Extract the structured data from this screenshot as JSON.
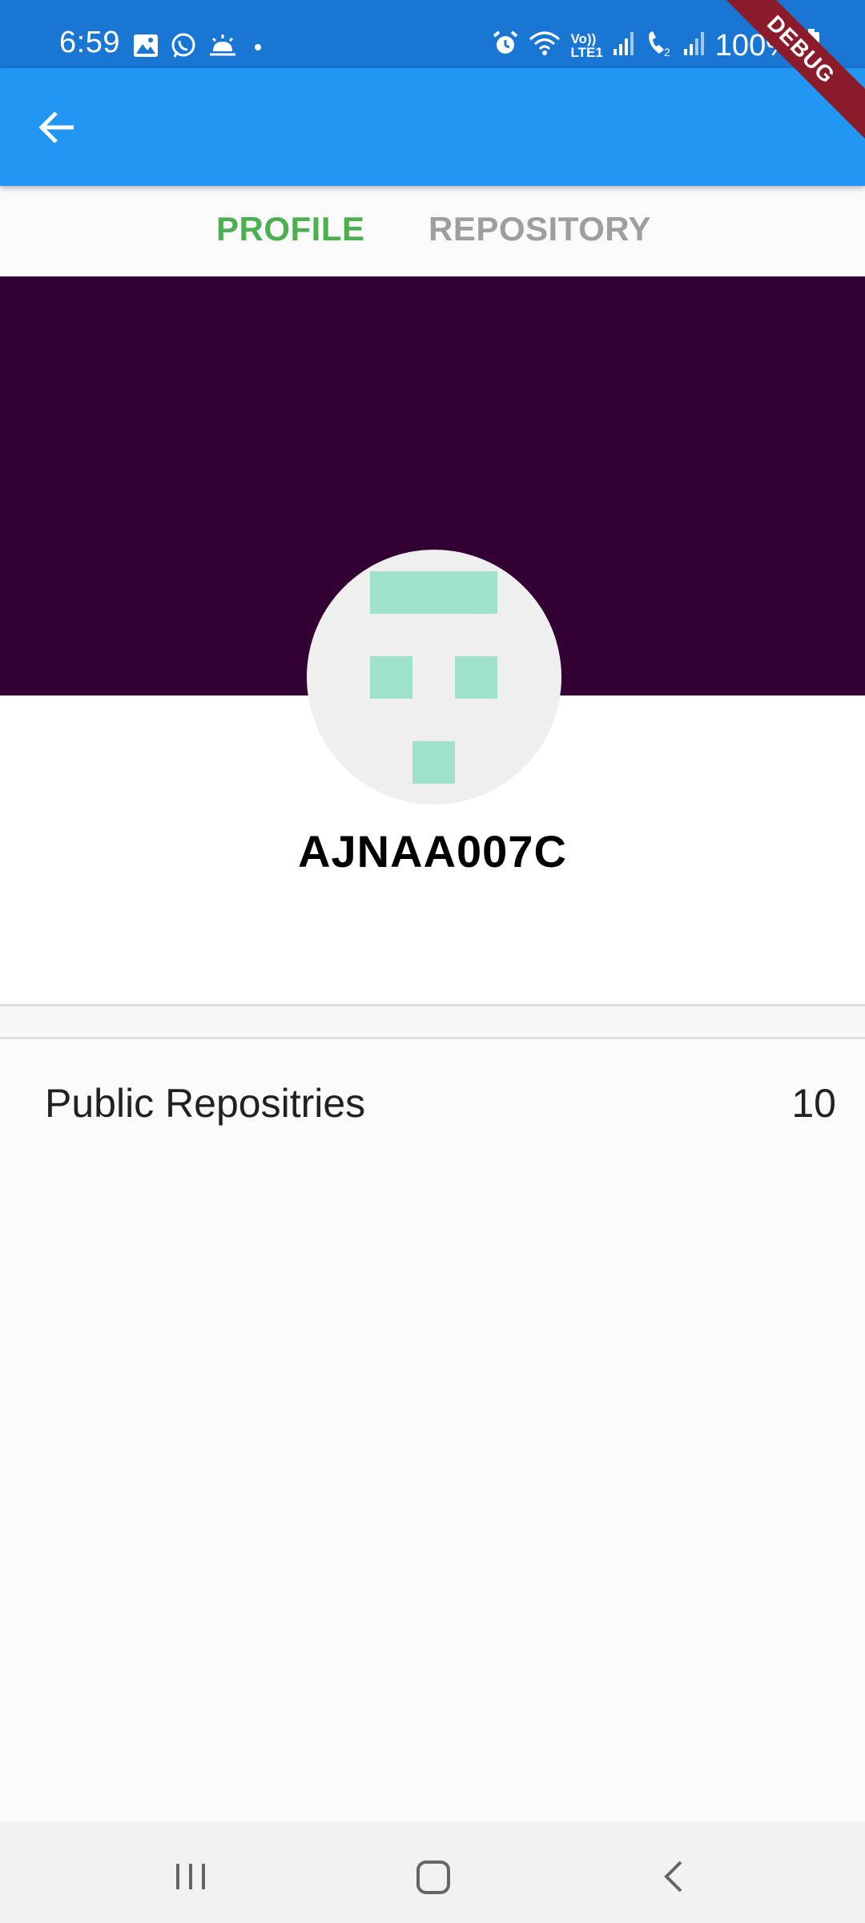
{
  "status_bar": {
    "time": "6:59",
    "battery": "100%",
    "left_icons": [
      "gallery-icon",
      "whatsapp-icon",
      "weather-icon",
      "dot-icon"
    ],
    "right_icons": [
      "alarm-icon",
      "wifi-icon",
      "volte-icon",
      "signal-icon",
      "call-icon",
      "signal-icon",
      "battery-icon"
    ],
    "volte_label": "Vo))",
    "lte_label": "LTE1"
  },
  "app_bar": {
    "back_icon": "arrow-left-icon",
    "color": "#2196f3"
  },
  "tabs": [
    {
      "label": "PROFILE",
      "active": true,
      "color": "#4caf50"
    },
    {
      "label": "REPOSITORY",
      "active": false,
      "color": "#9e9e9e"
    }
  ],
  "profile": {
    "banner_color": "#330033",
    "avatar_icon": "identicon-avatar",
    "avatar_color": "#a0e1cb",
    "username": "AJNAA007C"
  },
  "stats": [
    {
      "label": "Public Repositries",
      "value": "10"
    }
  ],
  "nav_bar": {
    "buttons": [
      "recents-icon",
      "home-icon",
      "back-icon"
    ]
  },
  "debug_banner": "DEBUG"
}
